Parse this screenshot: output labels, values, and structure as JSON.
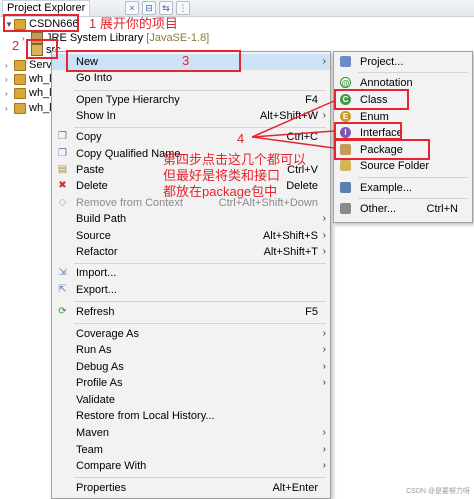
{
  "explorer": {
    "tab_label": "Project Explorer",
    "tree": [
      {
        "label": "CSDN666"
      },
      {
        "label": "JRE System Library",
        "suffix": "[JavaSE-1.8]"
      },
      {
        "label": "src"
      },
      {
        "label": "Serv"
      },
      {
        "label": "wh_l"
      },
      {
        "label": "wh_l"
      },
      {
        "label": "wh_l"
      }
    ]
  },
  "context_menu": {
    "items": [
      {
        "label": "New",
        "accel": ""
      },
      {
        "label": "Go Into",
        "accel": ""
      },
      {
        "label": "Open Type Hierarchy",
        "accel": "F4"
      },
      {
        "label": "Show In",
        "accel": "Alt+Shift+W"
      },
      {
        "label": "Copy",
        "accel": "Ctrl+C"
      },
      {
        "label": "Copy Qualified Name",
        "accel": ""
      },
      {
        "label": "Paste",
        "accel": "Ctrl+V"
      },
      {
        "label": "Delete",
        "accel": "Delete"
      },
      {
        "label": "Remove from Context",
        "accel": "Ctrl+Alt+Shift+Down"
      },
      {
        "label": "Build Path",
        "accel": ""
      },
      {
        "label": "Source",
        "accel": "Alt+Shift+S"
      },
      {
        "label": "Refactor",
        "accel": "Alt+Shift+T"
      },
      {
        "label": "Import...",
        "accel": ""
      },
      {
        "label": "Export...",
        "accel": ""
      },
      {
        "label": "Refresh",
        "accel": "F5"
      },
      {
        "label": "Coverage As",
        "accel": ""
      },
      {
        "label": "Run As",
        "accel": ""
      },
      {
        "label": "Debug As",
        "accel": ""
      },
      {
        "label": "Profile As",
        "accel": ""
      },
      {
        "label": "Validate",
        "accel": ""
      },
      {
        "label": "Restore from Local History...",
        "accel": ""
      },
      {
        "label": "Maven",
        "accel": ""
      },
      {
        "label": "Team",
        "accel": ""
      },
      {
        "label": "Compare With",
        "accel": ""
      },
      {
        "label": "Properties",
        "accel": "Alt+Enter"
      }
    ]
  },
  "new_submenu": {
    "items": [
      {
        "label": "Project...",
        "accel": ""
      },
      {
        "label": "Annotation",
        "accel": ""
      },
      {
        "label": "Class",
        "accel": ""
      },
      {
        "label": "Enum",
        "accel": ""
      },
      {
        "label": "Interface",
        "accel": ""
      },
      {
        "label": "Package",
        "accel": ""
      },
      {
        "label": "Source Folder",
        "accel": ""
      },
      {
        "label": "Example...",
        "accel": ""
      },
      {
        "label": "Other...",
        "accel": "Ctrl+N"
      }
    ]
  },
  "annotations": {
    "step1": "1 展开你的项目",
    "step2": "2",
    "step3": "3",
    "step4": "4",
    "note_lines": [
      "第四步点击这几个都可以",
      "但最好是将类和接口",
      "都放在package包中"
    ]
  },
  "watermark": "CSDN @是要努力呀",
  "colors": {
    "annotation_red": "#e3262f",
    "highlight": "#cce3f7"
  }
}
